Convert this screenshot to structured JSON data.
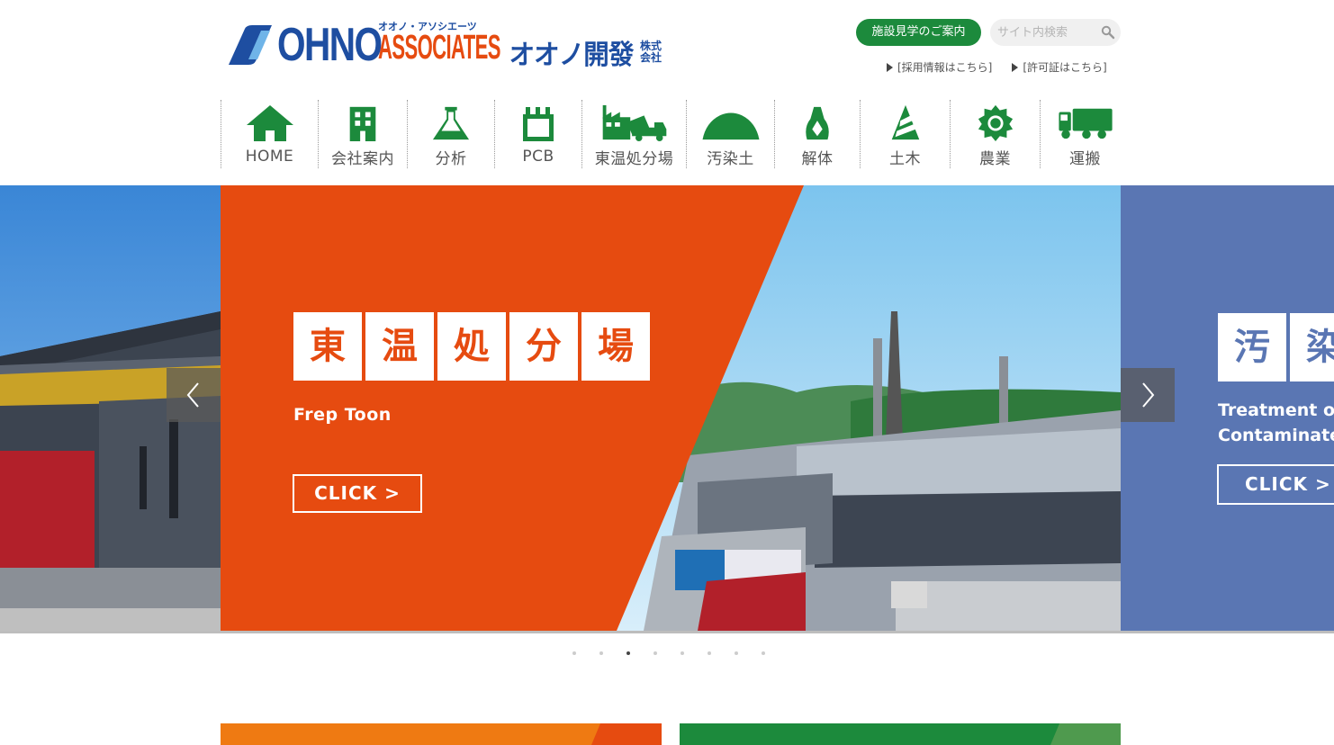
{
  "brand": {
    "ohno": "OHNO",
    "associates_kana": "オオノ・アソシエーツ",
    "associates": "ASSOCIATES",
    "kaihatsu": "オオノ開發",
    "kabushiki": "株式",
    "kaisha": "会社"
  },
  "header": {
    "tour_button": "施設見学のご案内",
    "search_placeholder": "サイト内検索",
    "links": [
      "[採用情報はこちら]",
      "[許可証はこちら]"
    ]
  },
  "nav": [
    {
      "label": "HOME",
      "icon": "house-icon"
    },
    {
      "label": "会社案内",
      "icon": "building-icon"
    },
    {
      "label": "分析",
      "icon": "flask-icon"
    },
    {
      "label": "PCB",
      "icon": "transformer-icon"
    },
    {
      "label": "東温処分場",
      "icon": "plant-truck-icon"
    },
    {
      "label": "汚染土",
      "icon": "soil-mound-icon"
    },
    {
      "label": "解体",
      "icon": "demolition-icon"
    },
    {
      "label": "土木",
      "icon": "cone-icon"
    },
    {
      "label": "農業",
      "icon": "sun-icon"
    },
    {
      "label": "運搬",
      "icon": "truck-icon"
    }
  ],
  "slider": {
    "main": {
      "title_chars": [
        "東",
        "温",
        "処",
        "分",
        "場"
      ],
      "subtitle": "Frep Toon",
      "button": "CLICK >"
    },
    "next": {
      "title_chars": [
        "汚",
        "染"
      ],
      "subtitle_line1": "Treatment of",
      "subtitle_line2": "Contaminate",
      "button": "CLICK >"
    },
    "dot_count": 8,
    "active_dot": 3
  },
  "colors": {
    "brand_blue": "#1e4ea1",
    "brand_orange": "#e64b10",
    "nav_green": "#1c8a3c",
    "slide_blue": "#5a76b3"
  }
}
